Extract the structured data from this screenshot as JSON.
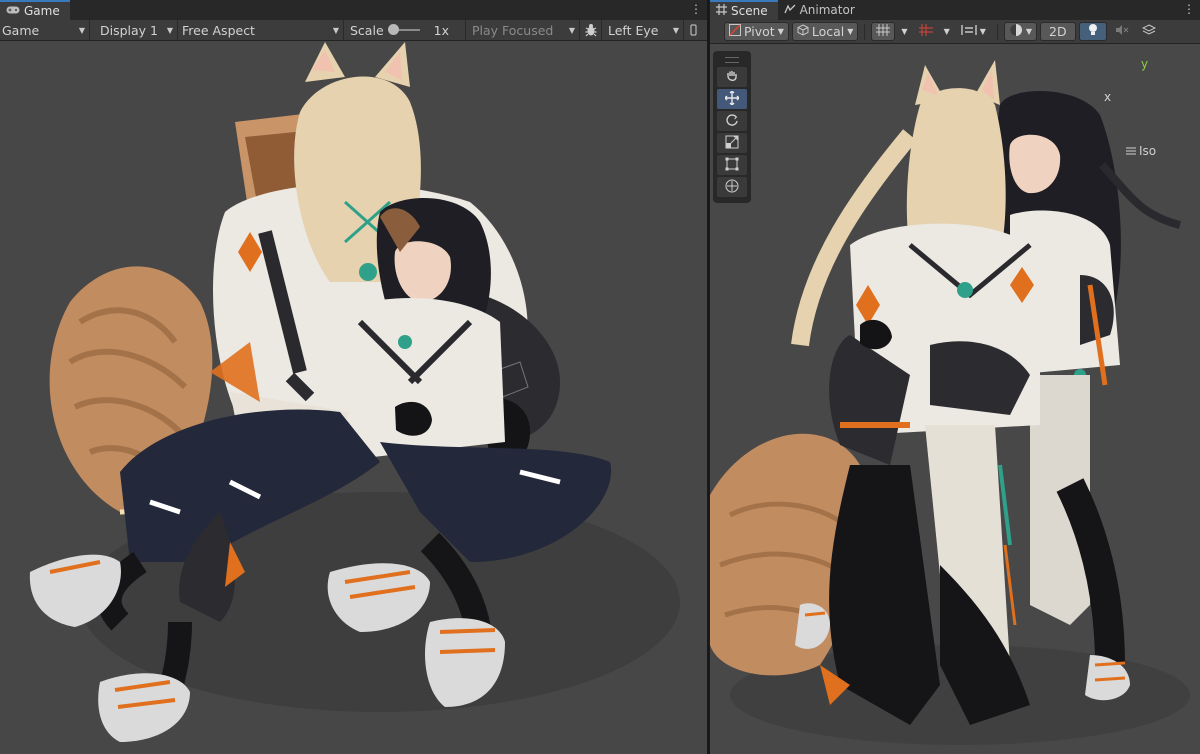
{
  "game_panel": {
    "tab_label": "Game",
    "toolbar": {
      "mode": "Game",
      "display": "Display 1",
      "aspect": "Free Aspect",
      "scale_label": "Scale",
      "scale_value": "1x",
      "play_focused": "Play Focused",
      "eye": "Left Eye"
    }
  },
  "scene_panel": {
    "tabs": [
      "Scene",
      "Animator"
    ],
    "toolbar": {
      "pivot": "Pivot",
      "local": "Local",
      "mode_2d": "2D"
    },
    "gizmo": {
      "axis_x": "x",
      "axis_y": "y",
      "projection": "Iso"
    }
  },
  "colors": {
    "accent_orange": "#e0701e",
    "fur": "#c8946a",
    "hair_blonde": "#e6d2ae",
    "hair_dark": "#1e1e24",
    "jacket_white": "#ece8e2",
    "pants_navy": "#23283a",
    "jade": "#2fa08a"
  }
}
